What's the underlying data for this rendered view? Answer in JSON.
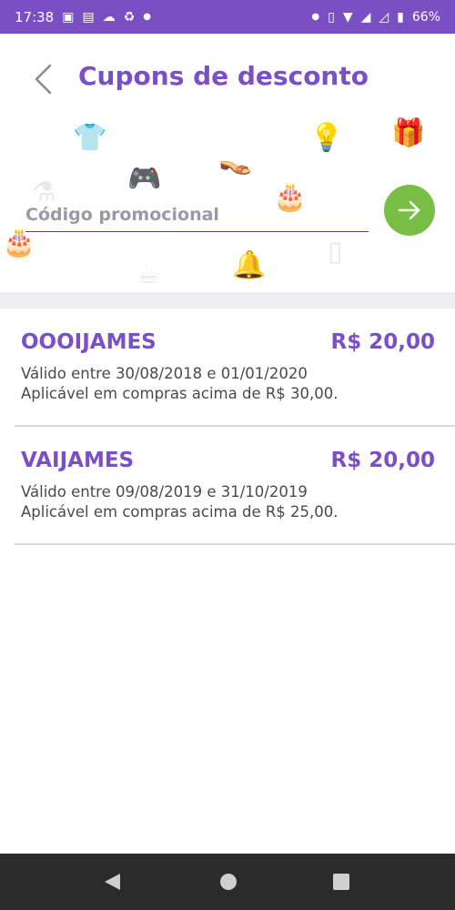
{
  "status_bar": {
    "time": "17:38",
    "battery": "66%",
    "icons_left": [
      "image-icon",
      "news-icon",
      "weather-icon",
      "recycle-icon",
      "dot"
    ],
    "icons_right": [
      "dot",
      "vibrate-icon",
      "wifi-icon",
      "signal-icon",
      "signal-icon",
      "battery-icon"
    ]
  },
  "header": {
    "title": "Cupons de desconto"
  },
  "promo": {
    "placeholder": "Código promocional",
    "value": ""
  },
  "coupons": [
    {
      "code": "OOOIJAMES",
      "value": "R$ 20,00",
      "validity": "Válido entre 30/08/2018 e 01/01/2020",
      "condition": "Aplicável em compras acima de R$ 30,00."
    },
    {
      "code": "VAIJAMES",
      "value": "R$ 20,00",
      "validity": "Válido entre 09/08/2019 e 31/10/2019",
      "condition": "Aplicável em compras acima de R$ 25,00."
    }
  ],
  "colors": {
    "accent": "#7b4fc6",
    "status_bar": "#7a4fc4",
    "submit": "#78be45",
    "nav_bar": "#2b2b2b"
  }
}
